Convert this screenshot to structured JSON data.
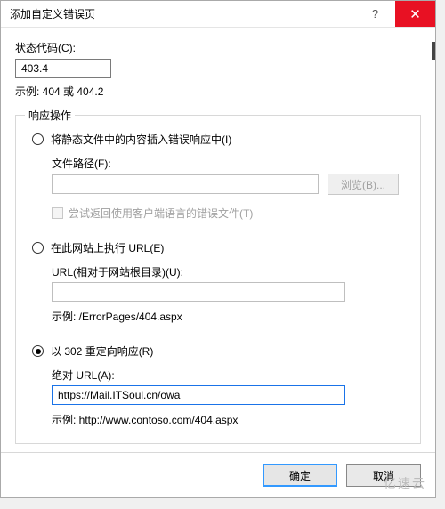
{
  "titlebar": {
    "title": "添加自定义错误页",
    "help": "?",
    "close": "✕"
  },
  "statusCode": {
    "label": "状态代码(C):",
    "value": "403.4",
    "hint": "示例: 404 或 404.2"
  },
  "group": {
    "legend": "响应操作",
    "staticFile": {
      "radioLabel": "将静态文件中的内容插入错误响应中(I)",
      "pathLabel": "文件路径(F):",
      "pathValue": "",
      "browseLabel": "浏览(B)...",
      "checkLabel": "尝试返回使用客户端语言的错误文件(T)"
    },
    "execUrl": {
      "radioLabel": "在此网站上执行 URL(E)",
      "urlLabel": "URL(相对于网站根目录)(U):",
      "urlValue": "",
      "hint": "示例: /ErrorPages/404.aspx"
    },
    "redirect": {
      "radioLabel": "以 302 重定向响应(R)",
      "absLabel": "绝对 URL(A):",
      "absValue": "https://Mail.ITSoul.cn/owa",
      "hint": "示例: http://www.contoso.com/404.aspx"
    },
    "selected": "redirect"
  },
  "footer": {
    "ok": "确定",
    "cancel": "取消"
  },
  "watermark": "亿速云"
}
